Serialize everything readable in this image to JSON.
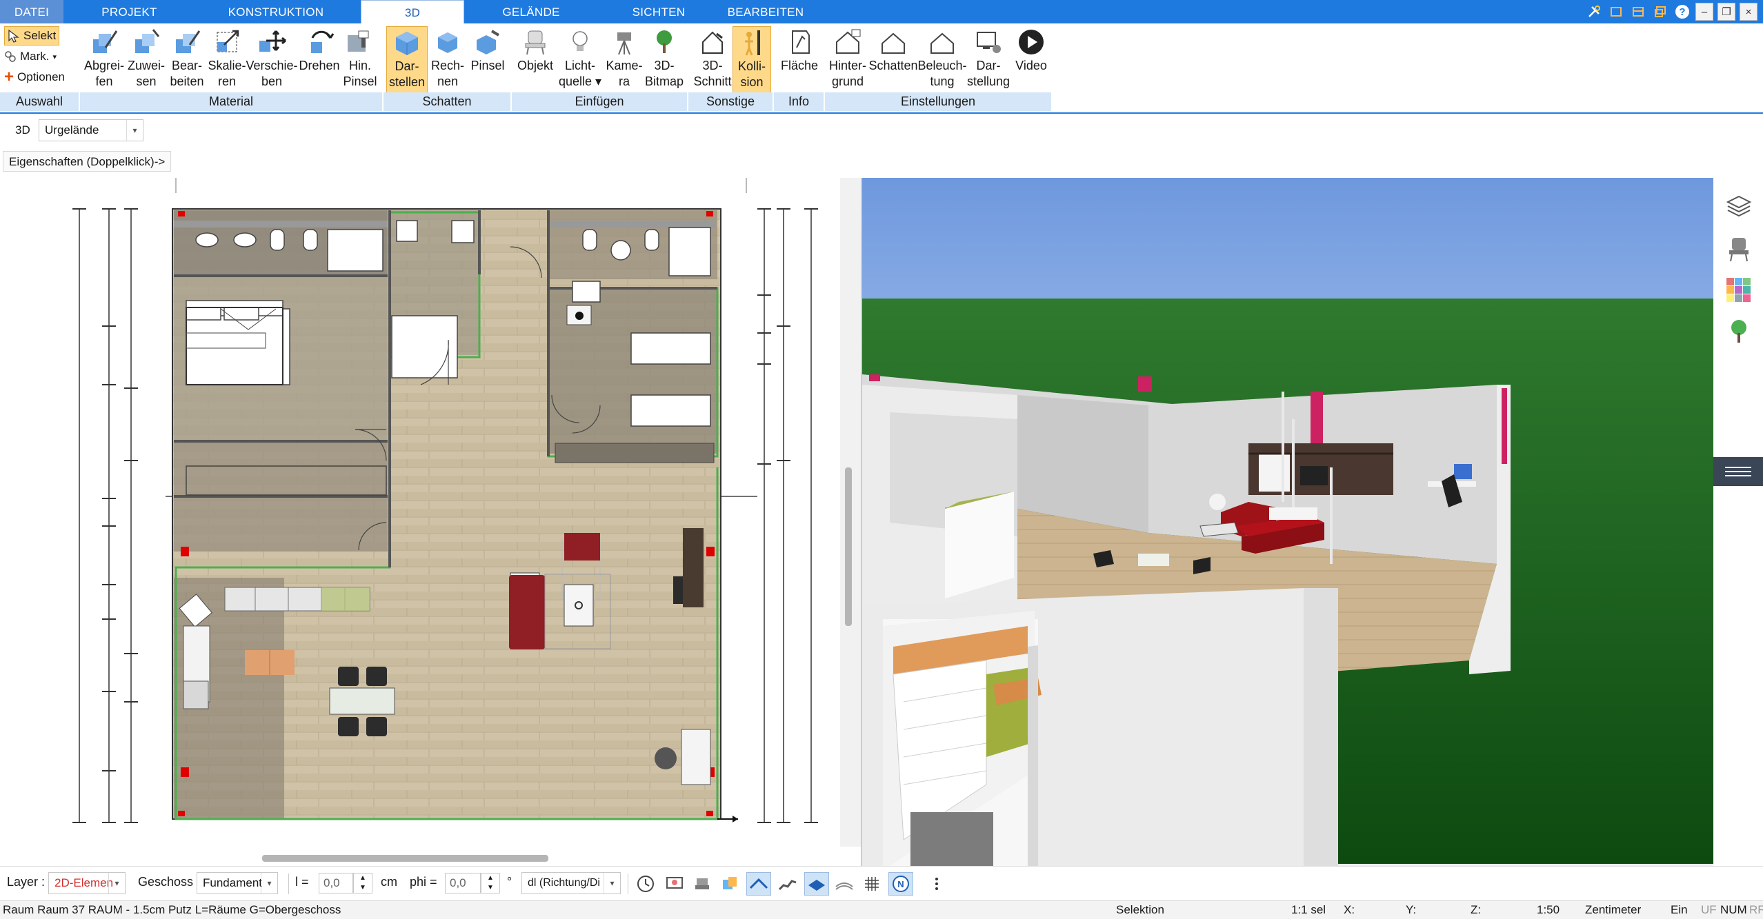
{
  "tabs": [
    {
      "label": "DATEI"
    },
    {
      "label": "PROJEKT"
    },
    {
      "label": "KONSTRUKTION"
    },
    {
      "label": "3D"
    },
    {
      "label": "GELÄNDE"
    },
    {
      "label": "SICHTEN"
    },
    {
      "label": "BEARBEITEN"
    }
  ],
  "active_tab": "3D",
  "selection": {
    "selekt": "Selekt",
    "mark": "Mark.",
    "optionen": "Optionen"
  },
  "ribbon_buttons": [
    {
      "l1": "Abgrei-",
      "l2": "fen",
      "icon": "eyedropper-icon"
    },
    {
      "l1": "Zuwei-",
      "l2": "sen",
      "icon": "assign-material-icon"
    },
    {
      "l1": "Bear-",
      "l2": "beiten",
      "icon": "edit-material-icon"
    },
    {
      "l1": "Skalie-",
      "l2": "ren",
      "icon": "scale-icon"
    },
    {
      "l1": "Verschie-",
      "l2": "ben",
      "icon": "move-icon"
    },
    {
      "l1": "Drehen",
      "l2": "",
      "icon": "rotate-icon"
    },
    {
      "l1": "Hin.",
      "l2": "Pinsel",
      "icon": "brush-icon"
    },
    {
      "l1": "Dar-",
      "l2": "stellen",
      "icon": "display-cube-icon"
    },
    {
      "l1": "Rech-",
      "l2": "nen",
      "icon": "calc-cube-icon"
    },
    {
      "l1": "Pinsel",
      "l2": "",
      "icon": "shadow-brush-icon"
    },
    {
      "l1": "Objekt",
      "l2": "",
      "icon": "chair-icon"
    },
    {
      "l1": "Licht-",
      "l2": "quelle ▾",
      "icon": "bulb-icon"
    },
    {
      "l1": "Kame-",
      "l2": "ra",
      "icon": "camera-icon"
    },
    {
      "l1": "3D-",
      "l2": "Bitmap",
      "icon": "tree-icon"
    },
    {
      "l1": "3D-",
      "l2": "Schnitt",
      "icon": "section-icon"
    },
    {
      "l1": "Kolli-",
      "l2": "sion",
      "icon": "collision-icon"
    },
    {
      "l1": "Fläche",
      "l2": "",
      "icon": "area-icon"
    },
    {
      "l1": "Hinter-",
      "l2": "grund",
      "icon": "background-icon"
    },
    {
      "l1": "Schatten",
      "l2": "",
      "icon": "shadow-house-icon"
    },
    {
      "l1": "Beleuch-",
      "l2": "tung",
      "icon": "lighting-house-icon"
    },
    {
      "l1": "Dar-",
      "l2": "stellung",
      "icon": "display-settings-icon"
    },
    {
      "l1": "Video",
      "l2": "",
      "icon": "play-icon"
    }
  ],
  "groups": [
    "Auswahl",
    "Material",
    "Schatten",
    "Einfügen",
    "Sonstige",
    "Info",
    "Einstellungen"
  ],
  "view_toolbar": {
    "mode": "3D",
    "terrain": "Urgelände",
    "properties_hint": "Eigenschaften (Doppelklick)->"
  },
  "bottom_toolbar": {
    "layer_label": "Layer :",
    "layer_value": "2D-Elemen",
    "geschoss_label": "Geschoss :",
    "geschoss_value": "Fundament",
    "l_label": "l =",
    "l_value": "0,0",
    "l_unit": "cm",
    "phi_label": "phi =",
    "phi_value": "0,0",
    "phi_unit": "°",
    "direction_value": "dl (Richtung/Di"
  },
  "status": {
    "info": "Raum Raum 37 RAUM - 1.5cm Putz L=Räume G=Obergeschoss",
    "mode": "Selektion",
    "sel": "1:1 sel",
    "x": "X:",
    "y": "Y:",
    "z": "Z:",
    "scale": "1:50",
    "unit": "Zentimeter",
    "ein": "Ein",
    "uf": "UF",
    "num": "NUM",
    "rf": "RF"
  },
  "colors": {
    "accent": "#1f7ae0",
    "selected": "#ffd98a",
    "group_bg": "#d5e6f8",
    "wall_green": "#4caf50",
    "sofa_red": "#b3121b"
  }
}
